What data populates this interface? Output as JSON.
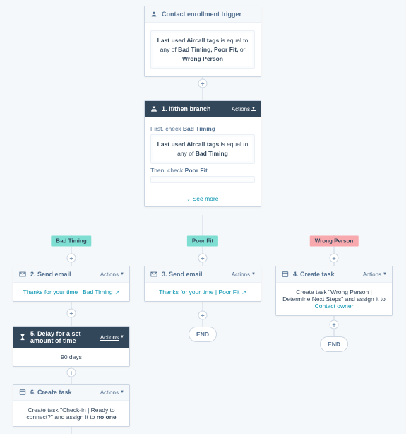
{
  "trigger": {
    "title": "Contact enrollment trigger",
    "condition_prefix": "Last used Aircall tags",
    "condition_op": " is equal to any of ",
    "condition_values": "Bad Timing, Poor Fit, ",
    "condition_or": "or ",
    "condition_last": "Wrong Person"
  },
  "branch": {
    "title": "1. If/then branch",
    "actions": "Actions",
    "first_check": "First, check ",
    "first_check_value": "Bad Timing",
    "cond1_prefix": "Last used Aircall tags",
    "cond1_op": " is equal to any of ",
    "cond1_value": "Bad Timing",
    "then_check": "Then, check ",
    "then_check_value": "Poor Fit",
    "see_more": "See more"
  },
  "labels": {
    "bad_timing": "Bad Timing",
    "poor_fit": "Poor Fit",
    "wrong_person": "Wrong Person",
    "end": "END"
  },
  "step2": {
    "title": "2. Send email",
    "actions": "Actions",
    "body": "Thanks for your time | Bad Timing"
  },
  "step3": {
    "title": "3. Send email",
    "actions": "Actions",
    "body": "Thanks for your time | Poor Fit"
  },
  "step4": {
    "title": "4. Create task",
    "actions": "Actions",
    "body_pre": "Create task \"Wrong Person | Determine Next Steps\" and assign it to ",
    "body_link": "Contact owner"
  },
  "step5": {
    "title": "5. Delay for a set amount of time",
    "actions": "Actions",
    "body": "90 days"
  },
  "step6": {
    "title": "6. Create task",
    "actions": "Actions",
    "body_pre": "Create task \"Check-in | Ready to connect?\" and assign it to ",
    "body_strong": "no one"
  }
}
